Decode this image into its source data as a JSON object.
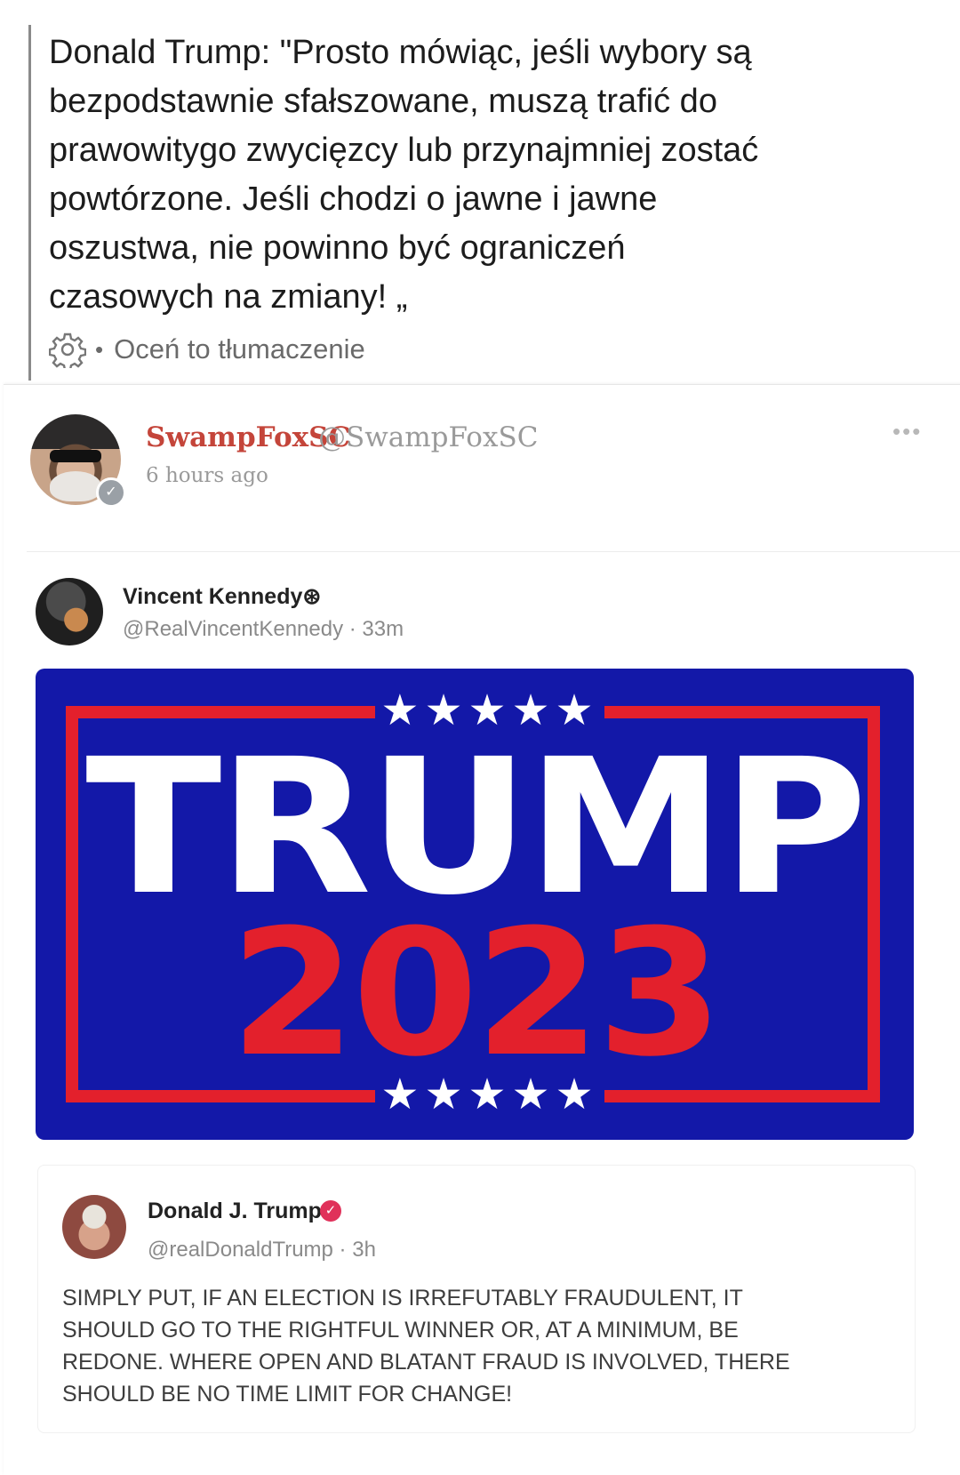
{
  "translation": {
    "quote_text": "Donald Trump: \"Prosto mówiąc, jeśli wybory są\nbezpodstawnie sfałszowane, muszą trafić do\nprawowitygo zwycięzcy lub przynajmniej zostać\npowtórzone. Jeśli chodzi o jawne i jawne\noszustwa, nie powinno być ograniczeń\nczasowych na zmiany! „",
    "separator": "•",
    "rate_label": "Oceń to tłumaczenie",
    "icon": "gear-icon"
  },
  "post": {
    "author_name": "SwampFoxSC",
    "author_handle": "@SwampFoxSC",
    "time": "6 hours ago",
    "more": "•••"
  },
  "embedded": {
    "author_name": "Vincent Kennedy⊛",
    "author_meta": "@RealVincentKennedy · 33m",
    "image": {
      "stars_top": "★★★★★",
      "word": "TRUMP",
      "year": "2023",
      "stars_bottom": "★★★★★",
      "colors": {
        "background": "#1318a8",
        "red": "#e3202c",
        "white": "#ffffff"
      }
    },
    "quoted": {
      "author_name": "Donald J. Trump",
      "verified_mark": "✓",
      "author_meta": "@realDonaldTrump · 3h",
      "body": "SIMPLY PUT, IF AN ELECTION IS IRREFUTABLY FRAUDULENT, IT\nSHOULD GO TO THE RIGHTFUL WINNER OR, AT A MINIMUM, BE\nREDONE. WHERE OPEN AND BLATANT FRAUD IS INVOLVED, THERE\nSHOULD BE NO TIME LIMIT FOR CHANGE!"
    }
  }
}
